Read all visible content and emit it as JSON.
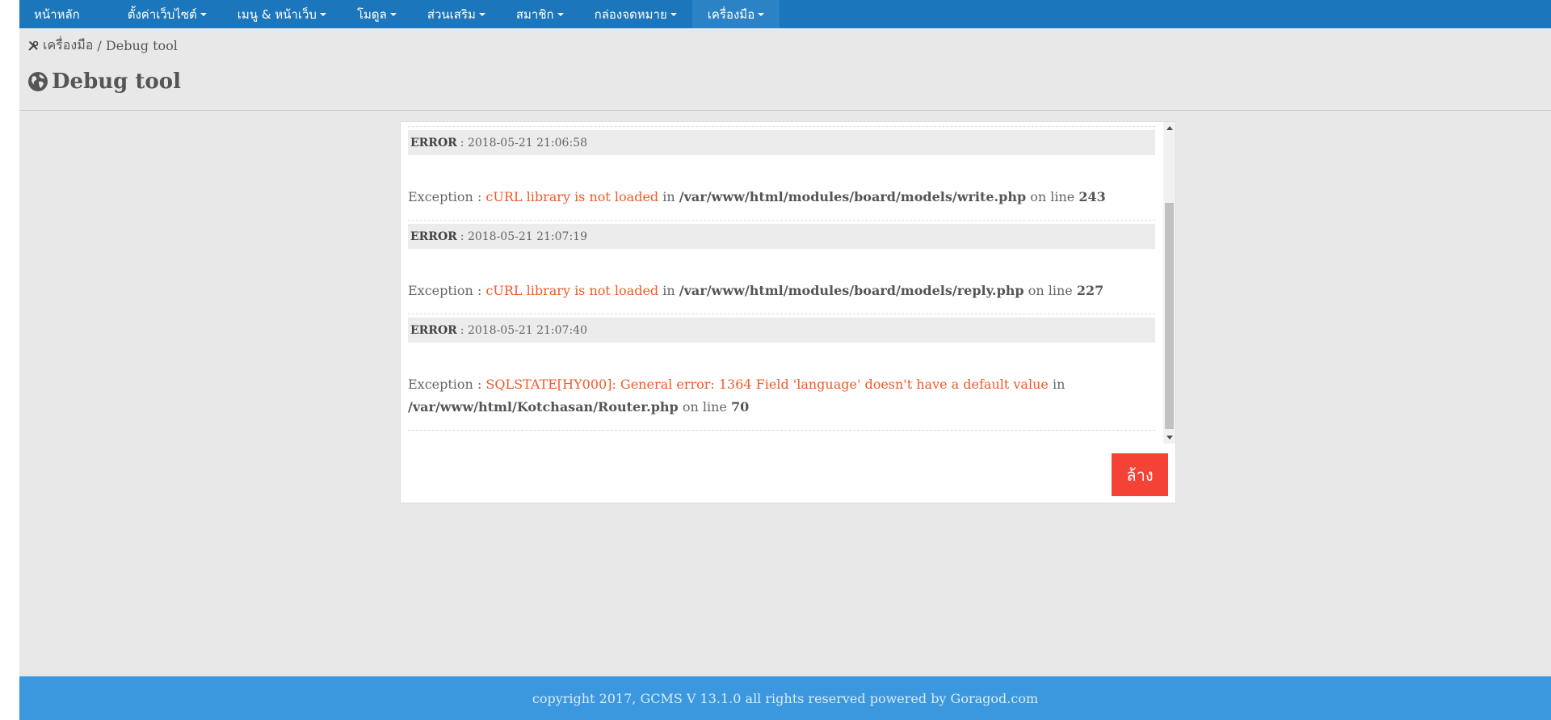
{
  "nav": {
    "items": [
      {
        "label": "หน้าหลัก",
        "dropdown": false
      },
      {
        "label": "ตั้งค่าเว็บไซต์",
        "dropdown": true
      },
      {
        "label": "เมนู & หน้าเว็บ",
        "dropdown": true
      },
      {
        "label": "โมดูล",
        "dropdown": true
      },
      {
        "label": "ส่วนเสริม",
        "dropdown": true
      },
      {
        "label": "สมาชิก",
        "dropdown": true
      },
      {
        "label": "กล่องจดหมาย",
        "dropdown": true
      },
      {
        "label": "เครื่องมือ",
        "dropdown": true,
        "active": true
      }
    ]
  },
  "breadcrumb": {
    "parent": "เครื่องมือ",
    "separator": " / ",
    "current": "Debug tool"
  },
  "page": {
    "title": "Debug tool"
  },
  "logs": [
    {
      "level": "ERROR",
      "timestamp": " : 2018-05-21 21:06:58",
      "prefix": "Exception : ",
      "message": "cURL library is not loaded",
      "in": " in ",
      "file": "/var/www/html/modules/board/models/write.php",
      "online": " on line ",
      "line": "243"
    },
    {
      "level": "ERROR",
      "timestamp": " : 2018-05-21 21:07:19",
      "prefix": "Exception : ",
      "message": "cURL library is not loaded",
      "in": " in ",
      "file": "/var/www/html/modules/board/models/reply.php",
      "online": " on line ",
      "line": "227"
    },
    {
      "level": "ERROR",
      "timestamp": " : 2018-05-21 21:07:40",
      "prefix": "Exception : ",
      "message": "SQLSTATE[HY000]: General error: 1364 Field 'language' doesn't have a default value",
      "in": " in",
      "file": "/var/www/html/Kotchasan/Router.php",
      "online": " on line ",
      "line": "70"
    }
  ],
  "actions": {
    "clear_label": "ล้าง"
  },
  "footer": {
    "text": "copyright 2017, GCMS V 13.1.0 all rights reserved powered by Goragod.com"
  },
  "colors": {
    "nav_bg": "#1b76bb",
    "footer_bg": "#3b97de",
    "error_message": "#f05a28",
    "clear_button": "#f44336"
  },
  "icons": {
    "breadcrumb": "tools-icon",
    "title": "globe-icon"
  }
}
